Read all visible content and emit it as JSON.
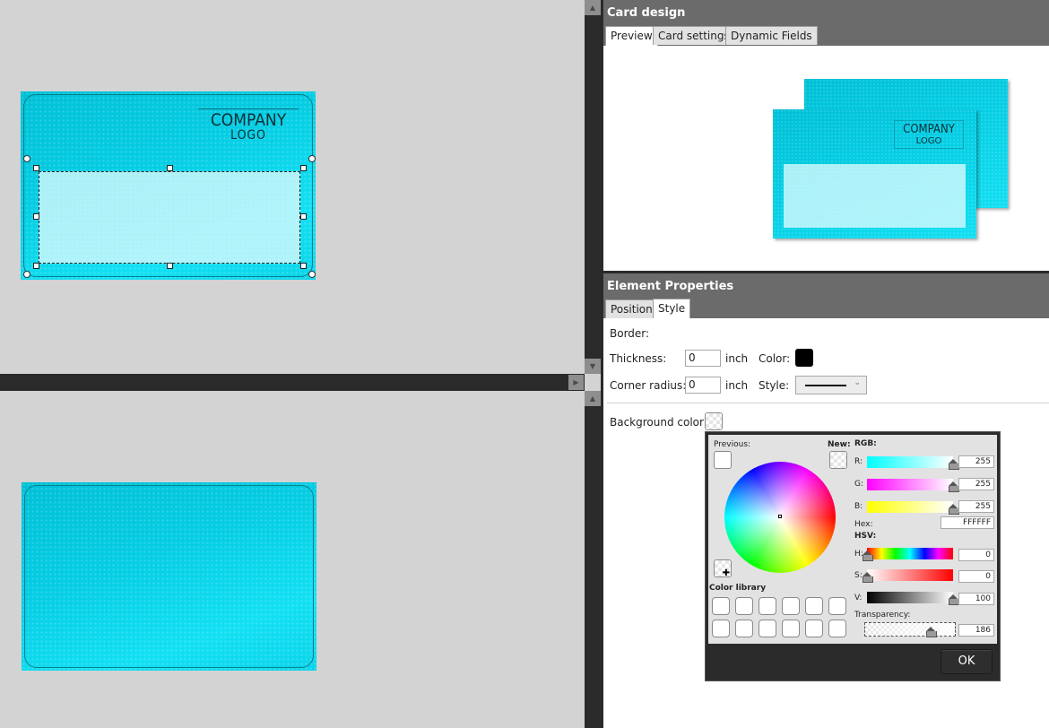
{
  "card_design": {
    "title": "Card design",
    "tabs": [
      {
        "label": "Preview",
        "active": true
      },
      {
        "label": "Card settings",
        "active": false
      },
      {
        "label": "Dynamic Fields",
        "active": false
      }
    ]
  },
  "card_canvas": {
    "front": {
      "logo_company": "COMPANY",
      "logo_word": "LOGO"
    },
    "preview": {
      "logo_company": "COMPANY",
      "logo_word": "LOGO"
    }
  },
  "element_properties": {
    "title": "Element Properties",
    "tabs": [
      {
        "label": "Position",
        "active": false
      },
      {
        "label": "Style",
        "active": true
      }
    ],
    "border_label": "Border:",
    "thickness_label": "Thickness:",
    "thickness_value": "0",
    "thickness_unit": "inch",
    "color_label": "Color:",
    "border_color": "#000000",
    "corner_radius_label": "Corner radius:",
    "corner_radius_value": "0",
    "corner_radius_unit": "inch",
    "style_label": "Style:",
    "style_value": "solid",
    "background_color_label": "Background color:"
  },
  "color_picker": {
    "previous_label": "Previous:",
    "new_label": "New:",
    "rgb_label": "RGB:",
    "r_label": "R:",
    "r_value": "255",
    "g_label": "G:",
    "g_value": "255",
    "b_label": "B:",
    "b_value": "255",
    "hex_label": "Hex:",
    "hex_value": "FFFFFF",
    "hsv_label": "HSV:",
    "h_label": "H:",
    "h_value": "0",
    "s_label": "S:",
    "s_value": "0",
    "v_label": "V:",
    "v_value": "100",
    "transparency_label": "Transparency:",
    "transparency_value": "186",
    "color_library_label": "Color library",
    "ok_label": "OK"
  }
}
